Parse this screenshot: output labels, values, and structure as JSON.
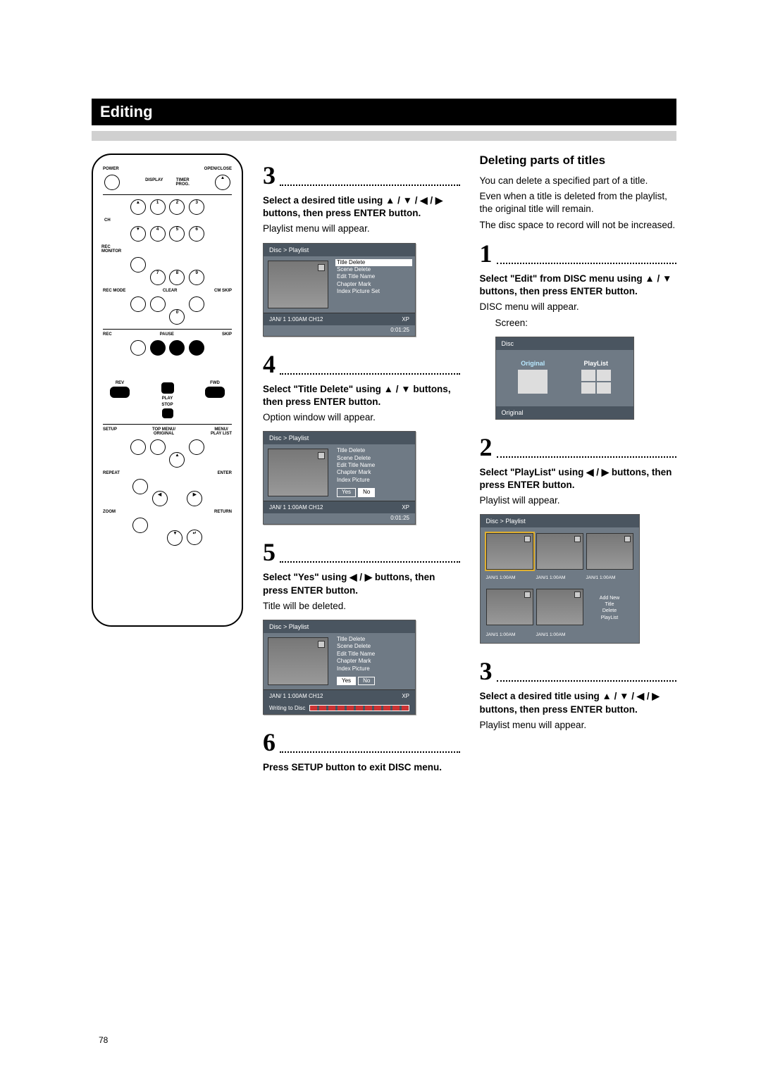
{
  "page_number": "78",
  "header": "Editing",
  "remote": {
    "labels": {
      "power": "POWER",
      "openclose": "OPEN/CLOSE",
      "display": "DISPLAY",
      "timer": "TIMER\nPROG.",
      "ch": "CH",
      "recmon": "REC\nMONITOR",
      "recmode": "REC MODE",
      "clear": "CLEAR",
      "cmskip": "CM SKIP",
      "rec": "REC",
      "pause": "PAUSE",
      "skip": "SKIP",
      "play": "PLAY",
      "rev": "REV",
      "fwd": "FWD",
      "stop": "STOP",
      "setup": "SETUP",
      "topmenu": "TOP MENU/\nORIGINAL",
      "menu": "MENU/\nPLAY LIST",
      "repeat": "REPEAT",
      "enter": "ENTER",
      "zoom": "ZOOM",
      "return": "RETURN"
    }
  },
  "col2": {
    "step3": {
      "num": "3",
      "bold": "Select a desired title using ▲ / ▼ / ◀ / ▶ buttons, then press ENTER button.",
      "text": "Playlist menu will appear."
    },
    "screenA": {
      "title": "Disc > Playlist",
      "menu": [
        "Title Delete",
        "Scene Delete",
        "Edit Title Name",
        "Chapter Mark",
        "Index Picture Set"
      ],
      "highlight": 0,
      "footer_left": "JAN/ 1   1:00AM  CH12",
      "footer_right": "XP",
      "subfoot": "0:01:25"
    },
    "step4": {
      "num": "4",
      "bold": "Select \"Title Delete\" using ▲ / ▼ buttons, then press ENTER button.",
      "text": "Option window will appear."
    },
    "screenB": {
      "title": "Disc > Playlist",
      "menu": [
        "Title Delete",
        "Scene Delete",
        "Edit Title Name",
        "Chapter Mark",
        "Index Picture"
      ],
      "yn_sel": "No",
      "footer_left": "JAN/ 1   1:00AM  CH12",
      "footer_right": "XP",
      "subfoot": "0:01:25"
    },
    "step5": {
      "num": "5",
      "bold": "Select \"Yes\" using ◀ / ▶ buttons, then press ENTER button.",
      "text": "Title will be deleted."
    },
    "screenC": {
      "title": "Disc > Playlist",
      "menu": [
        "Title Delete",
        "Scene Delete",
        "Edit Title Name",
        "Chapter Mark",
        "Index Picture"
      ],
      "yn_sel": "Yes",
      "footer_left": "JAN/ 1   1:00AM  CH12",
      "footer_right": "XP",
      "progress_label": "Writing to Disc"
    },
    "step6": {
      "num": "6",
      "bold": "Press SETUP button to exit DISC menu."
    }
  },
  "col3": {
    "heading": "Deleting parts of titles",
    "intro": [
      "You can delete a specified part of a title.",
      "Even when a title is deleted from the playlist, the original title will remain.",
      "The disc space to record will not be increased."
    ],
    "step1": {
      "num": "1",
      "bold": "Select \"Edit\" from DISC menu using ▲ / ▼ buttons, then press ENTER button.",
      "text": "DISC menu will appear.",
      "indent": "Screen:"
    },
    "discscreen": {
      "title": "Disc",
      "opt1": "Original",
      "opt2": "PlayList",
      "foot": "Original"
    },
    "step2": {
      "num": "2",
      "bold": "Select \"PlayList\" using ◀ / ▶ buttons, then press ENTER button.",
      "text": "Playlist will appear."
    },
    "gridscreen": {
      "title": "Disc > Playlist",
      "caption": "JAN/1  1:00AM",
      "opts": [
        "Add New",
        "Title",
        "Delete",
        "PlayList"
      ]
    },
    "step3": {
      "num": "3",
      "bold": "Select a desired title using ▲ / ▼ / ◀ / ▶ buttons, then press ENTER button.",
      "text": "Playlist menu will appear."
    }
  }
}
